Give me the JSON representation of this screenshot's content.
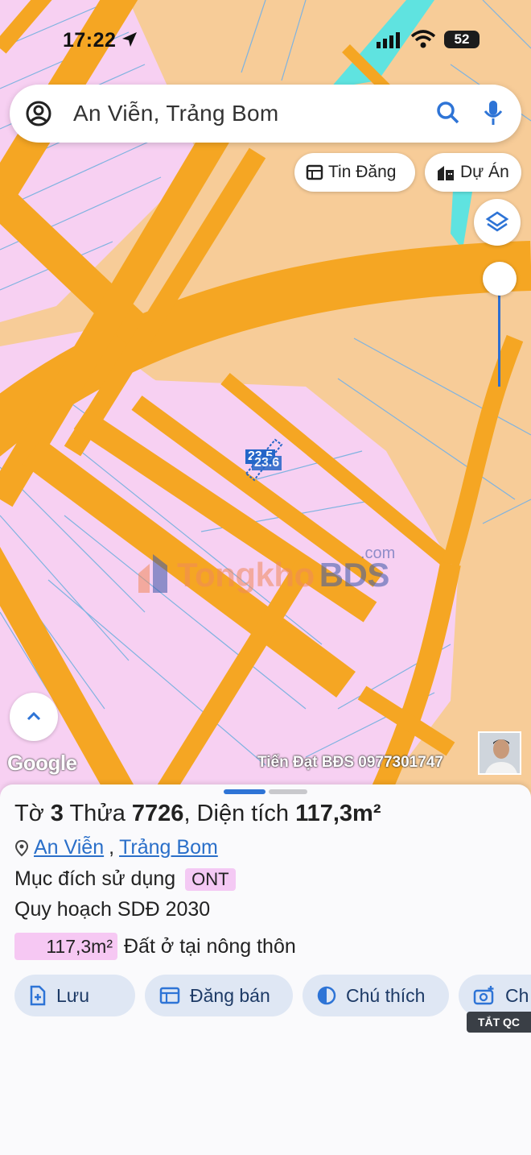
{
  "status_bar": {
    "time": "17:22",
    "battery": "52"
  },
  "search": {
    "query": "An Viễn, Trảng Bom"
  },
  "chips": {
    "tin_dang": "Tin Đăng",
    "du_an": "Dự Án"
  },
  "map": {
    "dim_label_a": "23.5",
    "dim_label_b": "23.6",
    "watermark_main": "Tongkho",
    "watermark_bds": "BDS",
    "watermark_com": ".com",
    "google_logo": "Google",
    "agent_text": "Tiến Đạt BĐS 0977301747",
    "colors": {
      "land": "#f7cc98",
      "residential": "#f7d0f2",
      "road": "#f5a623",
      "water": "#5fe3e0",
      "parcel_line": "#7fb3e0"
    }
  },
  "sheet": {
    "title_prefix": "Tờ ",
    "sheet_no": "3",
    "parcel_prefix": " Thửa ",
    "parcel_no": "7726",
    "area_prefix": ", Diện tích ",
    "area": "117,3m²",
    "location_commune": "An Viễn",
    "location_district": "Trảng Bom",
    "purpose_label": "Mục đích sử dụng",
    "purpose_code": "ONT",
    "plan_label": "Quy hoạch SDĐ 2030",
    "area_badge": "117,3m²",
    "area_desc": "Đất ở tại nông thôn",
    "actions": {
      "save": "Lưu",
      "post": "Đăng bán",
      "legend": "Chú thích",
      "capture": "Ch"
    },
    "ads_badge": "TẮT QC"
  }
}
